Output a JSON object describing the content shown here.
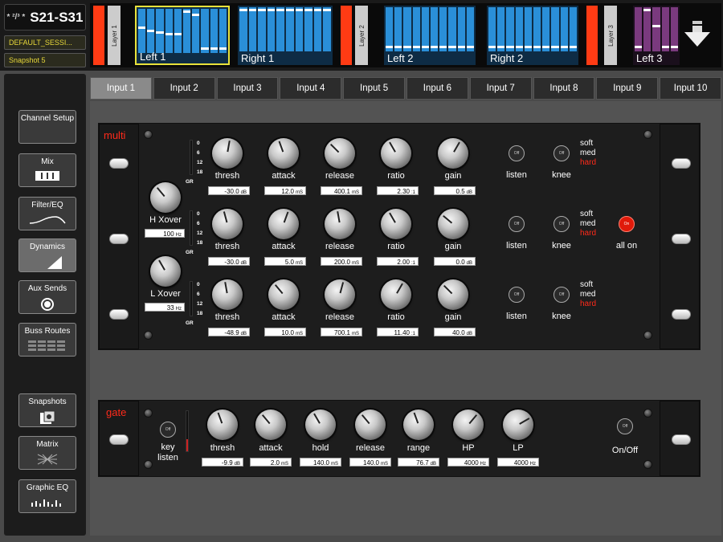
{
  "header": {
    "logo_text": "S21-S31",
    "logo_symbol": "* ²/³ *",
    "session": "DEFAULT_SESSI...",
    "snapshot": "Snapshot 5"
  },
  "layers": [
    {
      "tab": "Layer 1",
      "groups": [
        {
          "label": "Left 1"
        },
        {
          "label": "Right 1"
        }
      ]
    },
    {
      "tab": "Layer 2",
      "groups": [
        {
          "label": "Left 2"
        },
        {
          "label": "Right 2"
        }
      ]
    },
    {
      "tab": "Layer 3",
      "groups": [
        {
          "label": "Left 3"
        }
      ]
    }
  ],
  "sidebar": {
    "items": [
      {
        "label": "Channel Setup",
        "icon": "channel-setup-icon"
      },
      {
        "label": "Mix",
        "icon": "mix-icon"
      },
      {
        "label": "Filter/EQ",
        "icon": "filter-eq-icon"
      },
      {
        "label": "Dynamics",
        "icon": "dynamics-icon"
      },
      {
        "label": "Aux Sends",
        "icon": "aux-sends-icon"
      },
      {
        "label": "Buss Routes",
        "icon": "buss-routes-icon"
      },
      {
        "label": "Snapshots",
        "icon": "snapshots-icon"
      },
      {
        "label": "Matrix",
        "icon": "matrix-icon"
      },
      {
        "label": "Graphic EQ",
        "icon": "graphic-eq-icon"
      }
    ]
  },
  "tabs": [
    "Input 1",
    "Input 2",
    "Input 3",
    "Input 4",
    "Input 5",
    "Input 6",
    "Input 7",
    "Input 8",
    "Input 9",
    "Input 10"
  ],
  "multi": {
    "title": "multi",
    "gr_scale": [
      "0",
      "6",
      "12",
      "18",
      "GR"
    ],
    "h_xover": {
      "label": "H Xover",
      "value": "100",
      "unit": "Hz"
    },
    "l_xover": {
      "label": "L Xover",
      "value": "33",
      "unit": "Hz"
    },
    "labels": {
      "thresh": "thresh",
      "attack": "attack",
      "release": "release",
      "ratio": "ratio",
      "gain": "gain",
      "listen": "listen",
      "knee": "knee",
      "off": "Off",
      "on": "On",
      "all_on": "all on"
    },
    "knee_opts": [
      "soft",
      "med",
      "hard"
    ],
    "bands": [
      {
        "thresh": "-30.0",
        "thresh_u": "dB",
        "attack": "12.0",
        "attack_u": "mS",
        "release": "400.1",
        "release_u": "mS",
        "ratio": "2.30",
        "ratio_u": ":1",
        "gain": "0.5",
        "gain_u": "dB"
      },
      {
        "thresh": "-30.0",
        "thresh_u": "dB",
        "attack": "5.0",
        "attack_u": "mS",
        "release": "200.0",
        "release_u": "mS",
        "ratio": "2.00",
        "ratio_u": ":1",
        "gain": "0.0",
        "gain_u": "dB"
      },
      {
        "thresh": "-48.9",
        "thresh_u": "dB",
        "attack": "10.0",
        "attack_u": "mS",
        "release": "700.1",
        "release_u": "mS",
        "ratio": "11.40",
        "ratio_u": ":1",
        "gain": "40.0",
        "gain_u": "dB"
      }
    ]
  },
  "gate": {
    "title": "gate",
    "key_listen": "key listen",
    "onoff": "On/Off",
    "off": "Off",
    "thresh": {
      "label": "thresh",
      "value": "-9.9",
      "unit": "dB"
    },
    "attack": {
      "label": "attack",
      "value": "2.0",
      "unit": "mS"
    },
    "hold": {
      "label": "hold",
      "value": "140.0",
      "unit": "mS"
    },
    "release": {
      "label": "release",
      "value": "140.0",
      "unit": "mS"
    },
    "range": {
      "label": "range",
      "value": "76.7",
      "unit": "dB"
    },
    "hp": {
      "label": "HP",
      "value": "4000",
      "unit": "Hz"
    },
    "lp": {
      "label": "LP",
      "value": "4000",
      "unit": "Hz"
    }
  },
  "colors": {
    "accent_red": "#ff2a1a",
    "meter_blue": "#2a8fd8",
    "layer3_purple": "#7a3a7e",
    "selected_outline": "#e8e23a"
  }
}
